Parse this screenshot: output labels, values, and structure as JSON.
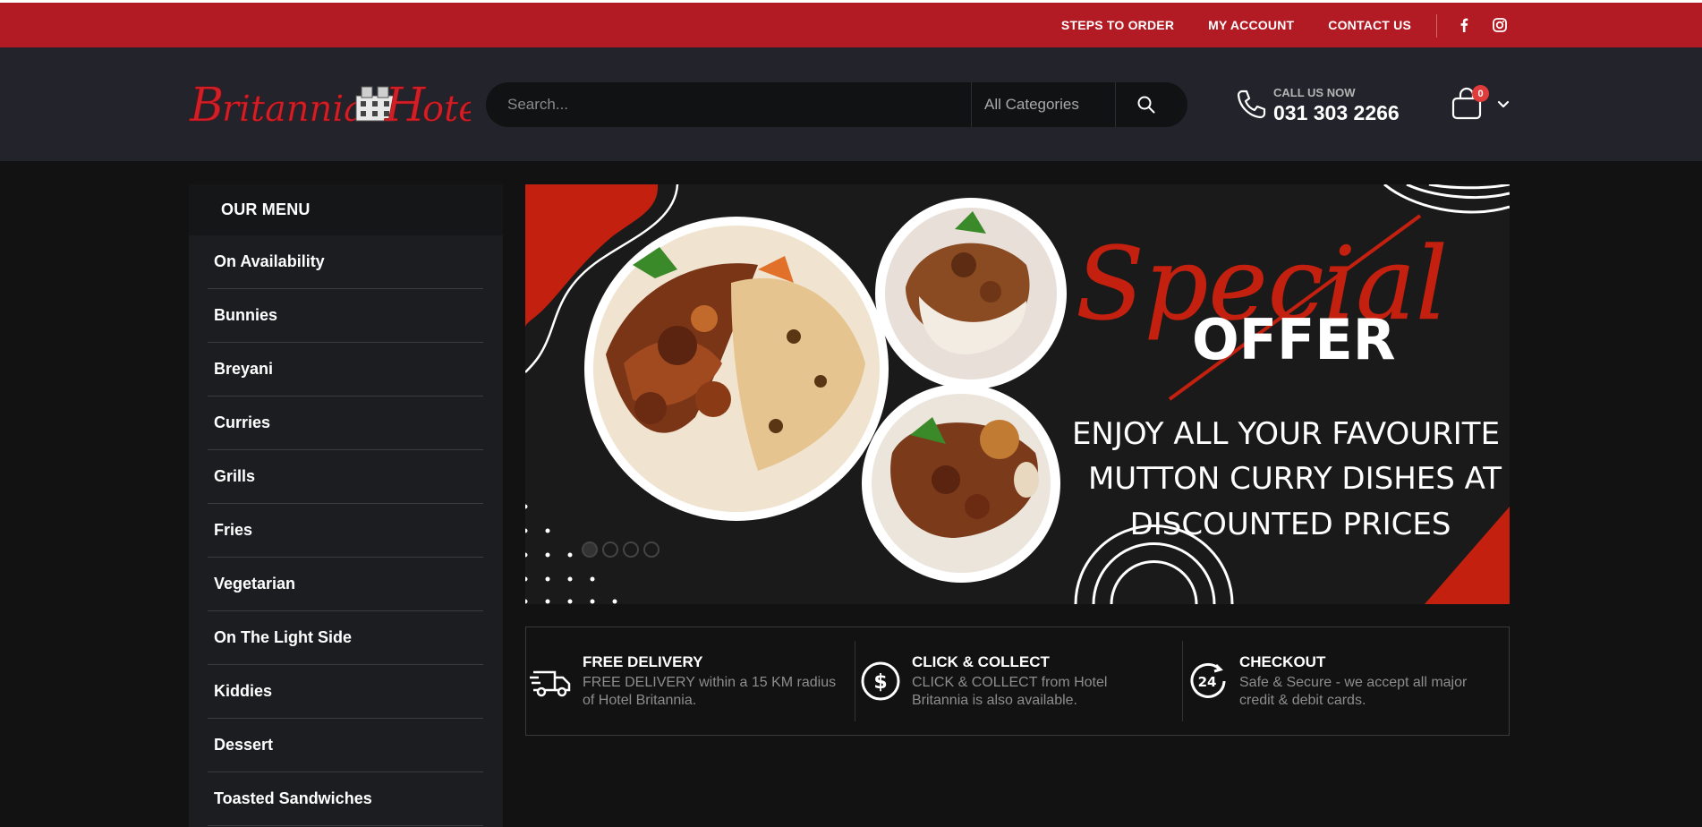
{
  "topbar": {
    "nav": [
      "STEPS TO ORDER",
      "MY ACCOUNT",
      "CONTACT US"
    ],
    "social": [
      "facebook-icon",
      "instagram-icon"
    ]
  },
  "header": {
    "logo_text": "Britannia Hotel",
    "search_placeholder": "Search...",
    "category": "All Categories",
    "call_label": "CALL US NOW",
    "call_number": "031 303 2266",
    "cart_count": "0"
  },
  "sidebar": {
    "title": "OUR MENU",
    "items": [
      "On Availability",
      "Bunnies",
      "Breyani",
      "Curries",
      "Grills",
      "Fries",
      "Vegetarian",
      "On The Light Side",
      "Kiddies",
      "Dessert",
      "Toasted Sandwiches"
    ]
  },
  "banner": {
    "script_text": "Special",
    "offer_text": "OFFER",
    "line1": "ENJOY ALL YOUR FAVOURITE",
    "line2": "MUTTON CURRY DISHES AT",
    "line3": "DISCOUNTED PRICES",
    "accent_color": "#c4200f"
  },
  "features": [
    {
      "icon": "truck-icon",
      "title": "FREE DELIVERY",
      "line1": "FREE DELIVERY within a 15 KM radius",
      "line2": "of Hotel Britannia."
    },
    {
      "icon": "dollar-icon",
      "title": "CLICK & COLLECT",
      "line1": "CLICK & COLLECT from Hotel",
      "line2": "Britannia is also available."
    },
    {
      "icon": "clock-24-icon",
      "title": "CHECKOUT",
      "line1": "Safe & Secure - we accept all major",
      "line2": "credit & debit cards."
    }
  ]
}
